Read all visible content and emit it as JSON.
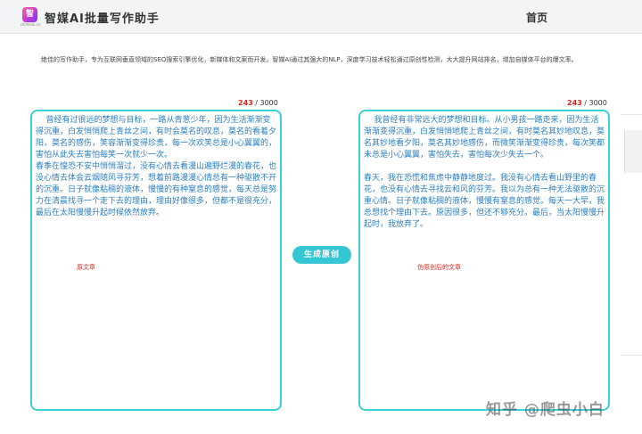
{
  "header": {
    "logo_text": "智",
    "logo_subtext": "zhimeiai.cn",
    "title": "智媒AI批量写作助手",
    "nav_home": "首页"
  },
  "intro": "绝佳的写作助手，专为互联网垂直领域的SEO搜索引擎优化，新媒体和文案而开发。智媒AI通过其强大的NLP，深度学习技术轻松通过原创性检测，大大提升网站排名，增加自媒体平台的爆文率。",
  "left_panel": {
    "count": "243",
    "max": "/ 3000",
    "text": "    曾经有过很远的梦想与目标，一路从青葱少年，因为生活渐渐变得沉重，白发悄悄爬上青丝之间，有时会莫名的叹息，莫名的看着夕阳，莫名的感伤，笑容渐渐变得珍贵，每一次欢笑总是小心翼翼的，害怕从此失去害怕每笑一次就少一次。\n春季在惶恐不安中悄悄溜过，没有心情去看漫山遍野烂漫的春花，也没心情去体会云烟随风寻芬芳，想着前路漫漫心情总有一种驱散不开的沉重。日子就像粘稠的液体，慢慢的有种窒息的感觉，每天总是努力在清晨找寻一个走下去的理由，理由好像很多，但都不是很充分，最后在太阳慢慢升起时候依然放弃。",
    "caption": "原文章"
  },
  "generate_button": "生成原创",
  "right_panel": {
    "count": "243",
    "max": "/ 3000",
    "text": "    我曾经有非常远大的梦想和目标。从小男孩一路走来，因为生活渐渐变得沉重，白发悄悄地爬上青丝之间，有时莫名其妙地叹息，莫名其妙地看夕阳，莫名其妙地感伤，而微笑渐渐变得珍贵，每次笑都未总是小心翼翼，害怕失去，害怕每次少失去一个。\n\n春天，我在恐慌和焦虑中静静地度过。我没有心情去看山野里的春花，也没有心情去寻找云和风的芬芳。我以为总有一种无法驱散的沉重心情。日子就像粘稠的液体，慢慢有窒息的感觉。每天一大早，我总想找个理由下去。原因很多，但还不够充分。最后，当太阳慢慢升起时，我放弃了。",
    "caption": "伪原创后的文章"
  },
  "watermark": "知乎 @爬虫小白",
  "colors": {
    "accent": "#34c6d2",
    "text_blue": "#2b7fbf",
    "caption_red": "#e0241b"
  }
}
